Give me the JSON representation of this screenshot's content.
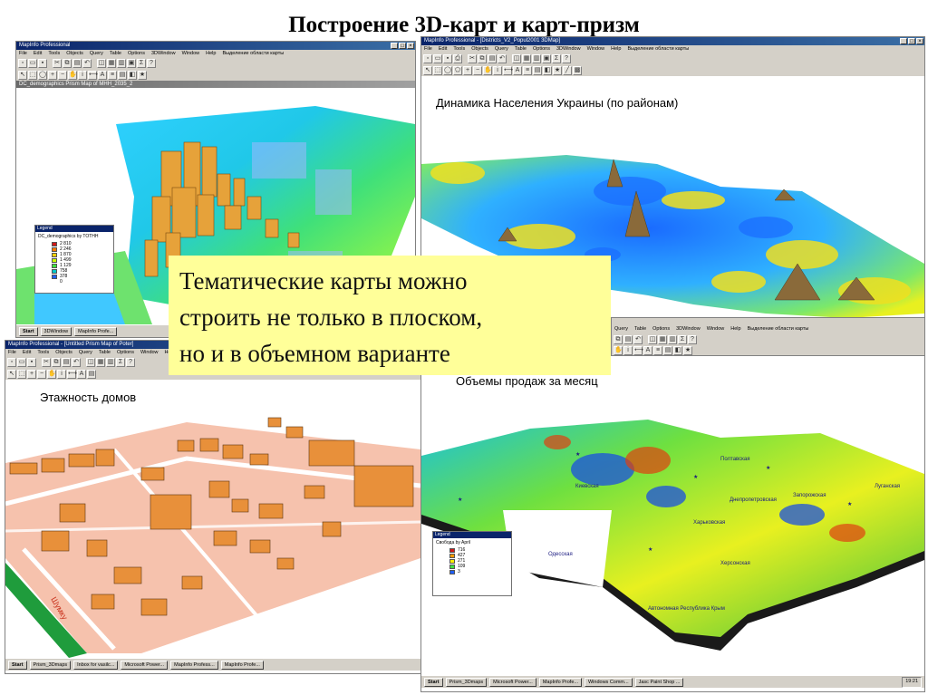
{
  "slide": {
    "title": "Построение 3D-карт и карт-призм",
    "callout_lines": [
      "Тематические карты можно",
      "строить не только в плоском,",
      "но и в объемном варианте"
    ]
  },
  "win_tl": {
    "title": "MapInfo Professional",
    "menu": [
      "File",
      "Edit",
      "Tools",
      "Objects",
      "Query",
      "Table",
      "Options",
      "3DWindow",
      "Window",
      "Help",
      "Выделение области карты"
    ],
    "doc_title": "DC_demographics Prism Map of MHH_2035_2",
    "legend": {
      "title": "Legend",
      "subtitle": "DC_demographics by TOTHH",
      "colors": [
        "#d01818",
        "#ff7a00",
        "#ffd000",
        "#c8ff00",
        "#40e040",
        "#00c8c8",
        "#2060ff"
      ],
      "values": [
        "2 810",
        "2 246",
        "1 870",
        "1 499",
        "1 129",
        "758",
        "378"
      ],
      "min": "0"
    },
    "taskbar": {
      "start": "Start",
      "items": [
        "3DWindow",
        "MapInfo Profe..."
      ]
    }
  },
  "win_tr": {
    "title": "MapInfo Professional - [Districts_V2_Popul2001 3DMap]",
    "menu": [
      "File",
      "Edit",
      "Tools",
      "Objects",
      "Query",
      "Table",
      "Options",
      "3DWindow",
      "Window",
      "Help",
      "Выделение области карты"
    ],
    "caption": "Динамика Населения Украины (по районам)"
  },
  "win_br_top": {
    "menu": [
      "Query",
      "Table",
      "Options",
      "3DWindow",
      "Window",
      "Help",
      "Выделение области карты"
    ]
  },
  "win_bl": {
    "title": "MapInfo Professional - [Untitled Prism Map of Poter]",
    "menu": [
      "File",
      "Edit",
      "Tools",
      "Objects",
      "Query",
      "Table",
      "Options",
      "Window",
      "Help"
    ],
    "caption": "Этажность домов",
    "street_label": "Шумку",
    "taskbar": {
      "start": "Start",
      "items": [
        "Prism_3Dmaps",
        "Inbox for vasilc...",
        "Microsoft Power...",
        "MapInfo Profess...",
        "MapInfo Profe..."
      ]
    }
  },
  "win_br": {
    "caption": "Объемы продаж за месяц",
    "legend": {
      "title": "Legend",
      "subtitle": "Свобода by April",
      "colors": [
        "#d01818",
        "#ff9a00",
        "#ffee00",
        "#40e040",
        "#2060ff"
      ],
      "values": [
        "716",
        "427",
        "271",
        "109",
        "3"
      ]
    },
    "city_labels": [
      "Киевская",
      "Полтавская",
      "Харьковская",
      "Запорожская",
      "Херсонская",
      "Одесская",
      "Днепропетровская",
      "Луганская",
      "Автономная Республика Крым"
    ],
    "taskbar": {
      "start": "Start",
      "items": [
        "Prism_3Dmaps",
        "Microsoft Power...",
        "MapInfo Profe...",
        "Windows Comm...",
        "Jasc Paint Shop ..."
      ],
      "clock": "19:21"
    }
  }
}
